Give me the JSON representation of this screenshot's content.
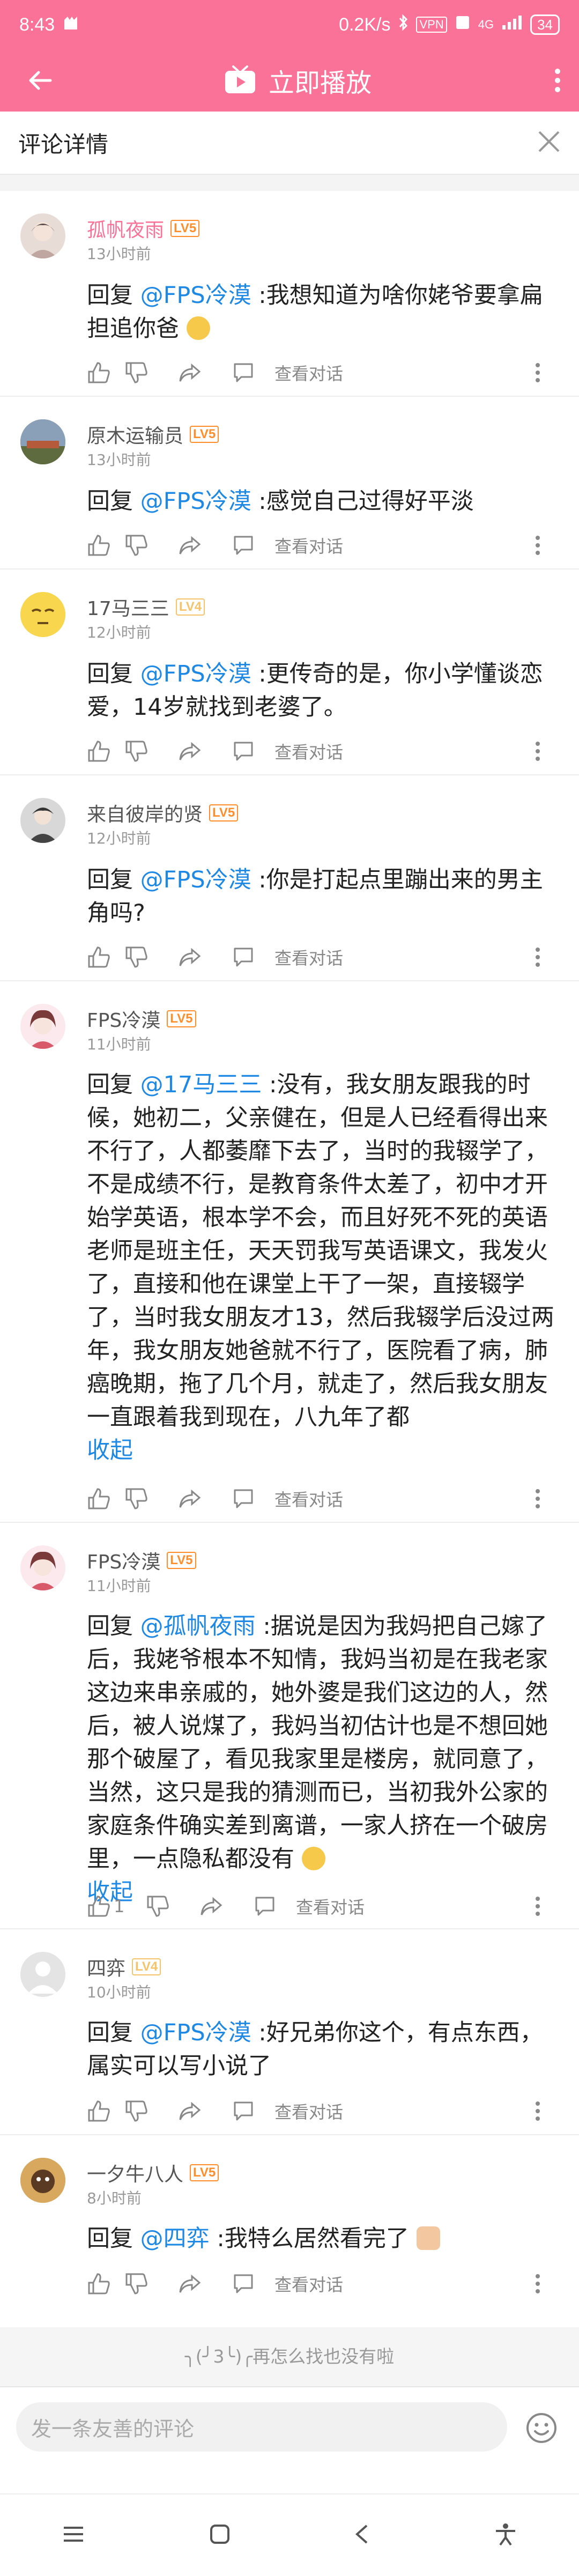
{
  "status_bar": {
    "time": "8:43",
    "network_speed": "0.2K/s",
    "vpn": "VPN",
    "signal_label": "4G",
    "battery": "34"
  },
  "app_bar": {
    "title": "立即播放"
  },
  "subheader": {
    "title": "评论详情"
  },
  "view_dialog_label": "查看对话",
  "fold_label": "收起",
  "comments": [
    {
      "user": "孤帆夜雨",
      "level": "LV5",
      "time": "13小时前",
      "prefix": "回复 ",
      "mention": "@FPS冷漠",
      "body": " :我想知道为啥你姥爷要拿扁担追你爸",
      "likes": ""
    },
    {
      "user": "原木运输员",
      "level": "LV5",
      "time": "13小时前",
      "prefix": "回复 ",
      "mention": "@FPS冷漠",
      "body": " :感觉自己过得好平淡",
      "likes": ""
    },
    {
      "user": "17马三三",
      "level": "LV4",
      "time": "12小时前",
      "prefix": "回复 ",
      "mention": "@FPS冷漠",
      "body": " :更传奇的是，你小学懂谈恋爱，14岁就找到老婆了。",
      "likes": ""
    },
    {
      "user": "来自彼岸的贤",
      "level": "LV5",
      "time": "12小时前",
      "prefix": "回复 ",
      "mention": "@FPS冷漠",
      "body": " :你是打起点里蹦出来的男主角吗?",
      "likes": ""
    },
    {
      "user": "FPS冷漠",
      "level": "LV5",
      "time": "11小时前",
      "prefix": "回复 ",
      "mention": "@17马三三",
      "body": " :没有，我女朋友跟我的时候，她初二，父亲健在，但是人已经看得出来不行了，人都萎靡下去了，当时的我辍学了，不是成绩不行，是教育条件太差了，初中才开始学英语，根本学不会，而且好死不死的英语老师是班主任，天天罚我写英语课文，我发火了，直接和他在课堂上干了一架，直接辍学了，当时我女朋友才13，然后我辍学后没过两年，我女朋友她爸就不行了，医院看了病，肺癌晚期，拖了几个月，就走了，然后我女朋友一直跟着我到现在，八九年了都",
      "likes": ""
    },
    {
      "user": "FPS冷漠",
      "level": "LV5",
      "time": "11小时前",
      "prefix": "回复 ",
      "mention": "@孤帆夜雨",
      "body": " :据说是因为我妈把自己嫁了后，我姥爷根本不知情，我妈当初是在我老家这边来串亲戚的，她外婆是我们这边的人，然后，被人说煤了，我妈当初估计也是不想回她那个破屋了，看见我家里是楼房，就同意了，当然，这只是我的猜测而已，当初我外公家的家庭条件确实差到离谱，一家人挤在一个破房里，一点隐私都没有",
      "likes": "1"
    },
    {
      "user": "四弈",
      "level": "LV4",
      "time": "10小时前",
      "prefix": "回复 ",
      "mention": "@FPS冷漠",
      "body": " :好兄弟你这个，有点东西，属实可以写小说了",
      "likes": ""
    },
    {
      "user": "一夕牛八人",
      "level": "LV5",
      "time": "8小时前",
      "prefix": "回复 ",
      "mention": "@四弈",
      "body": " :我特么居然看完了",
      "likes": ""
    }
  ],
  "footer_note": "╮(╯3╰)╭再怎么找也没有啦",
  "input": {
    "placeholder": "发一条友善的评论"
  },
  "colors": {
    "brand": "#fb7299",
    "link": "#1e88e5"
  }
}
